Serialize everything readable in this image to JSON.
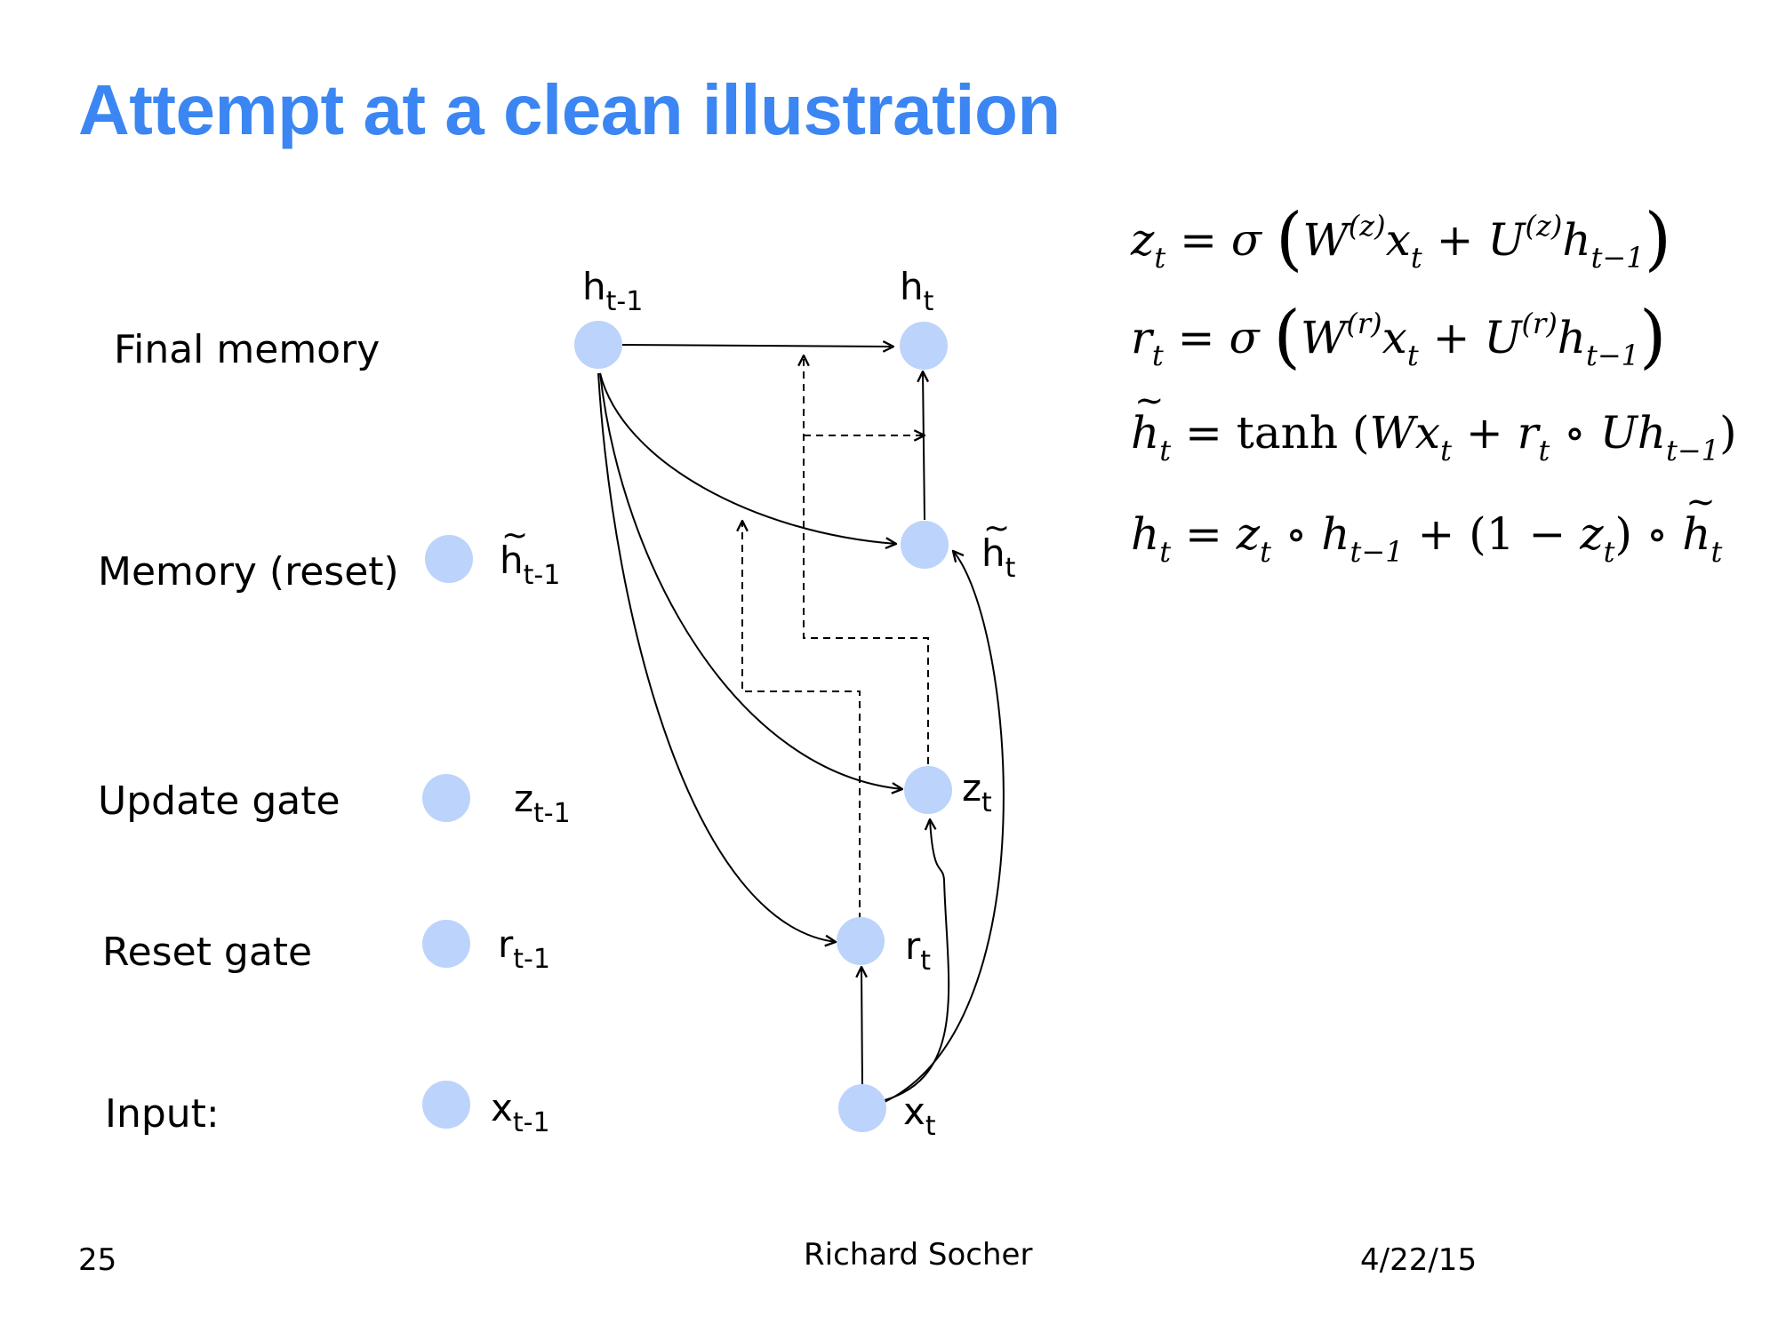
{
  "title": "Attempt at a clean illustration",
  "rows": {
    "final_memory": "Final memory",
    "memory_reset": "Memory (reset)",
    "update_gate": "Update gate",
    "reset_gate": "Reset gate",
    "input": "Input:"
  },
  "node_labels": {
    "h_prev": {
      "base": "h",
      "sub": "t-1"
    },
    "h_t": {
      "base": "h",
      "sub": "t"
    },
    "htilde_prev": {
      "base": "h",
      "sub": "t-1"
    },
    "htilde_t": {
      "base": "h",
      "sub": "t"
    },
    "z_prev": {
      "base": "z",
      "sub": "t-1"
    },
    "z_t": {
      "base": "z",
      "sub": "t"
    },
    "r_prev": {
      "base": "r",
      "sub": "t-1"
    },
    "r_t": {
      "base": "r",
      "sub": "t"
    },
    "x_prev": {
      "base": "x",
      "sub": "t-1"
    },
    "x_t": {
      "base": "x",
      "sub": "t"
    }
  },
  "equations": [
    "z_t = σ(W^(z) x_t + U^(z) h_{t−1})",
    "r_t = σ(W^(r) x_t + U^(r) h_{t−1})",
    "h̃_t = tanh(W x_t + r_t ∘ U h_{t−1})",
    "h_t = z_t ∘ h_{t−1} + (1 − z_t) ∘ h̃_t"
  ],
  "footer": {
    "page": "25",
    "author": "Richard Socher",
    "date": "4/22/15"
  },
  "colors": {
    "title": "#3b86f2",
    "node": "#bcd3fb"
  }
}
